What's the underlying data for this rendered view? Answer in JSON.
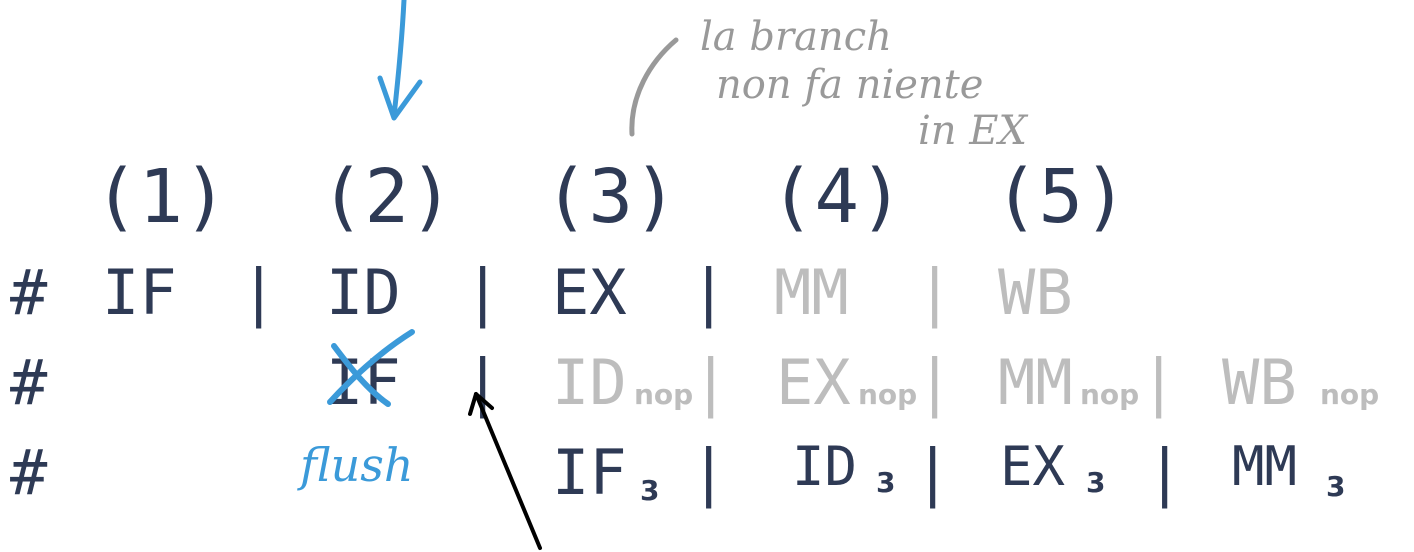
{
  "stages": [
    "(1)",
    "(2)",
    "(3)",
    "(4)",
    "(5)"
  ],
  "rows": [
    {
      "marker": "#",
      "cells": [
        "IF",
        "|",
        "ID",
        "|",
        "EX",
        "|",
        "MM",
        "|",
        "WB"
      ]
    },
    {
      "marker": "#",
      "cells": [
        "IF",
        "|",
        "ID",
        "|",
        "EX",
        "|",
        "MM",
        "|",
        "WB"
      ],
      "subscript": "nop"
    },
    {
      "marker": "#",
      "cells": [
        "IF",
        "|",
        "ID",
        "|",
        "EX",
        "|",
        "MM"
      ],
      "subscript": "3"
    }
  ],
  "annotations": {
    "note_line1": "la branch",
    "note_line2": "non fa niente",
    "note_line3": "in EX",
    "flush_label": "flush"
  },
  "colors": {
    "ink": "#2e3a55",
    "faded": "#bdbdbd",
    "pen_blue": "#3b9ad9",
    "pen_grey": "#999999",
    "pen_black": "#000000"
  }
}
